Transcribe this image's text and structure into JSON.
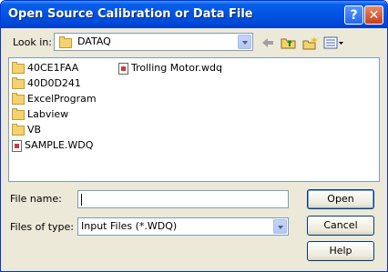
{
  "window": {
    "title": "Open Source Calibration or Data File",
    "help_glyph": "?",
    "close_glyph": "✕"
  },
  "lookin": {
    "label": "Look in:",
    "value": "DATAQ"
  },
  "toolbar": {
    "back_icon": "back-arrow-icon",
    "up_icon": "up-folder-icon",
    "new_icon": "new-folder-icon",
    "view_icon": "view-menu-icon"
  },
  "files": [
    {
      "name": "40CE1FAA",
      "type": "folder"
    },
    {
      "name": "40D0D241",
      "type": "folder"
    },
    {
      "name": "ExcelProgram",
      "type": "folder"
    },
    {
      "name": "Labview",
      "type": "folder"
    },
    {
      "name": "VB",
      "type": "folder"
    },
    {
      "name": "SAMPLE.WDQ",
      "type": "wdq-file"
    },
    {
      "name": "Trolling Motor.wdq",
      "type": "wdq-file"
    }
  ],
  "filename": {
    "label": "File name:",
    "value": ""
  },
  "filetype": {
    "label": "Files of type:",
    "value": "Input Files (*.WDQ)"
  },
  "buttons": {
    "open": "Open",
    "cancel": "Cancel",
    "help": "Help"
  }
}
